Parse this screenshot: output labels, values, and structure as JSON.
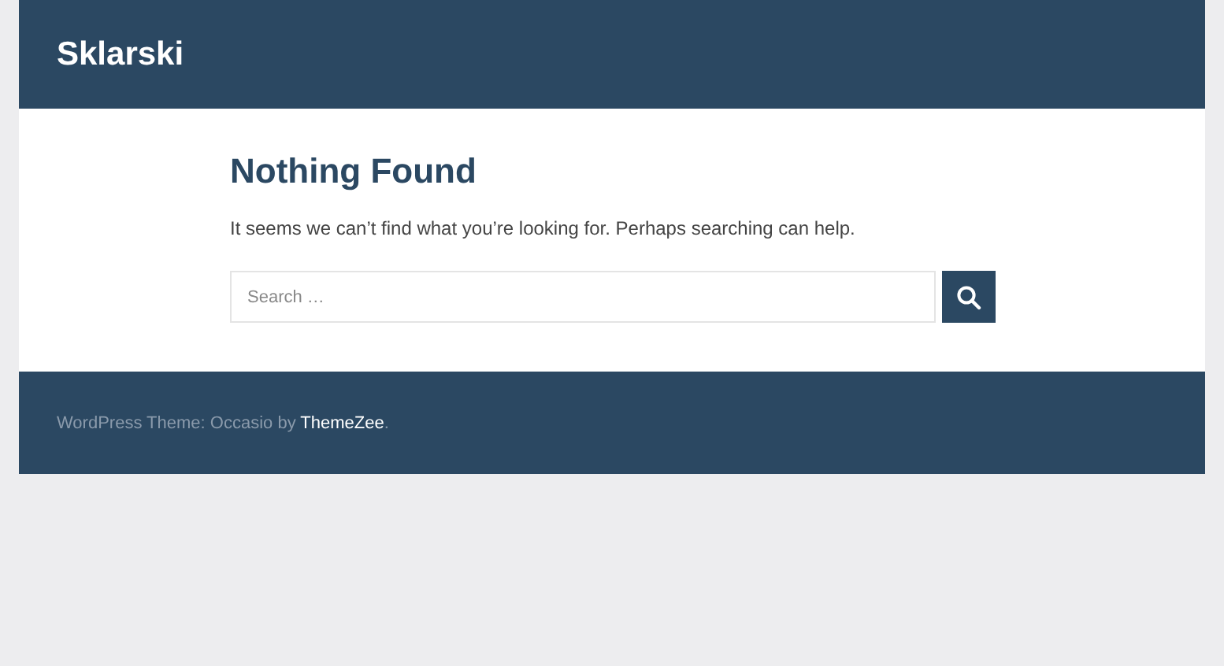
{
  "header": {
    "site_title": "Sklarski"
  },
  "content": {
    "title": "Nothing Found",
    "message": "It seems we can’t find what you’re looking for. Perhaps searching can help.",
    "search": {
      "placeholder": "Search …"
    }
  },
  "footer": {
    "text_before": "WordPress Theme: Occasio by ",
    "link": "ThemeZee",
    "text_after": "."
  }
}
